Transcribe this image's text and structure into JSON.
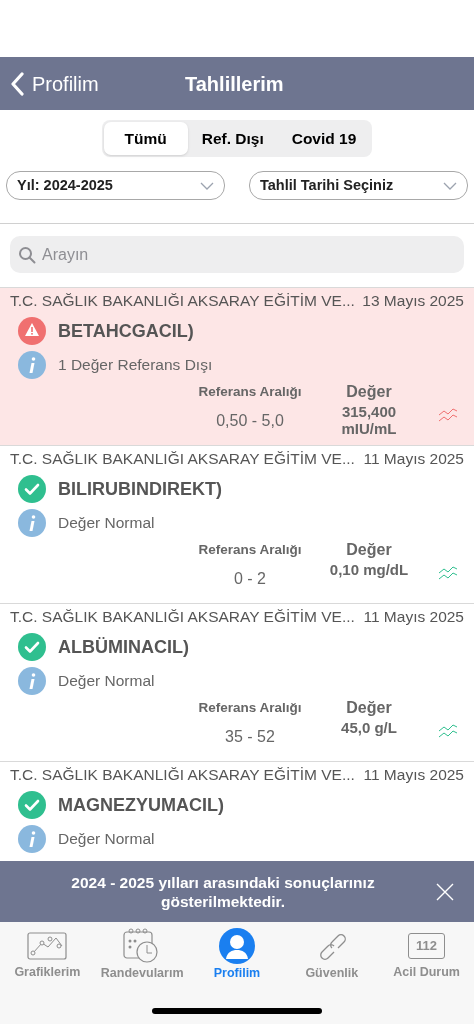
{
  "header": {
    "back_label": "Profilim",
    "title": "Tahlillerim"
  },
  "segments": [
    {
      "label": "Tümü",
      "selected": true
    },
    {
      "label": "Ref. Dışı",
      "selected": false
    },
    {
      "label": "Covid 19",
      "selected": false
    }
  ],
  "filters": [
    {
      "value": "Yıl: 2024-2025"
    },
    {
      "value": "Tahlil Tarihi Seçiniz"
    }
  ],
  "search": {
    "placeholder": "Arayın"
  },
  "results": [
    {
      "hospital": "T.C. SAĞLIK BAKANLIĞI AKSARAY EĞİTİM VE...",
      "date": "13 Mayıs 2025",
      "out_of_range": true,
      "test": "BETAHCGACIL)",
      "info": "1 Değer Referans Dışı",
      "range_label": "Referans Aralığı",
      "value_label": "Değer",
      "range": "0,50 - 5,0",
      "value": "315,400 mIU/mL"
    },
    {
      "hospital": "T.C. SAĞLIK BAKANLIĞI AKSARAY EĞİTİM VE...",
      "date": "11 Mayıs 2025",
      "out_of_range": false,
      "test": "BILIRUBINDIREKT)",
      "info": "Değer Normal",
      "range_label": "Referans Aralığı",
      "value_label": "Değer",
      "range": "0 - 2",
      "value": "0,10 mg/dL"
    },
    {
      "hospital": "T.C. SAĞLIK BAKANLIĞI AKSARAY EĞİTİM VE...",
      "date": "11 Mayıs 2025",
      "out_of_range": false,
      "test": "ALBÜMINACIL)",
      "info": "Değer Normal",
      "range_label": "Referans Aralığı",
      "value_label": "Değer",
      "range": "35 - 52",
      "value": "45,0 g/L"
    },
    {
      "hospital": "T.C. SAĞLIK BAKANLIĞI AKSARAY EĞİTİM VE...",
      "date": "11 Mayıs 2025",
      "out_of_range": false,
      "test": "MAGNEZYUMACIL)",
      "info": "Değer Normal"
    }
  ],
  "banner": {
    "message": "2024 - 2025 yılları arasındaki sonuçlarınız gösterilmektedir."
  },
  "tabbar": [
    {
      "kind": "chart",
      "label": "Grafiklerim",
      "selected": false
    },
    {
      "kind": "calendar",
      "label": "Randevularım",
      "selected": false
    },
    {
      "kind": "profile",
      "label": "Profilim",
      "selected": true
    },
    {
      "kind": "link",
      "label": "Güvenlik",
      "selected": false
    },
    {
      "kind": "emergency",
      "label": "Acil Durum",
      "badge": "112",
      "selected": false
    }
  ]
}
